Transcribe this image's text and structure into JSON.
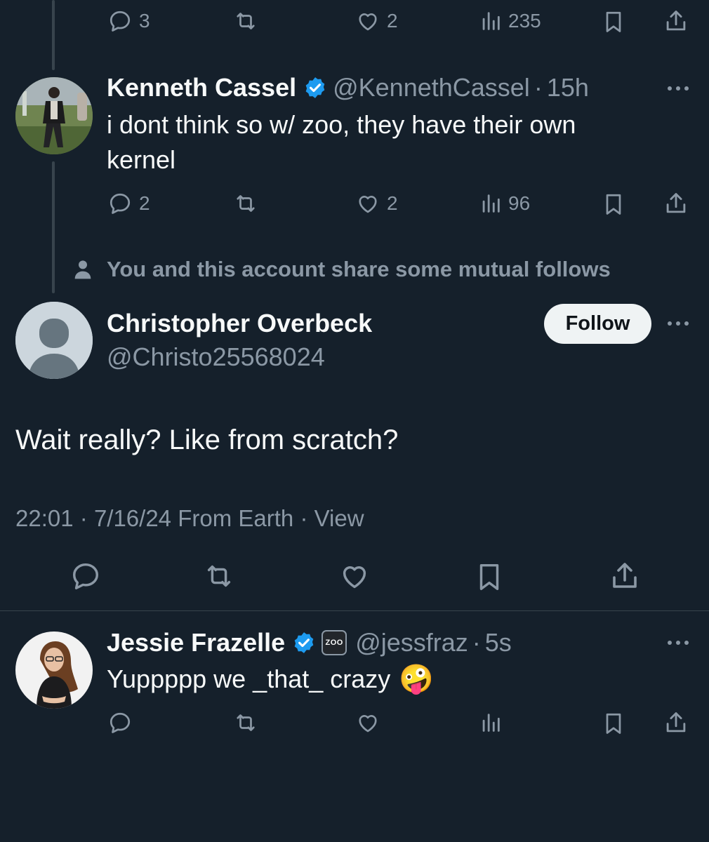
{
  "top_actions": {
    "replies": "3",
    "likes": "2",
    "views": "235"
  },
  "tweet1": {
    "name": "Kenneth Cassel",
    "handle": "@KennethCassel",
    "time": "15h",
    "text_line1": "i dont think so w/ zoo, they have their own",
    "text_line2": "kernel",
    "replies": "2",
    "likes": "2",
    "views": "96"
  },
  "mutual_follows": "You and this account share some mutual follows",
  "focus_tweet": {
    "name": "Christopher Overbeck",
    "handle": "@Christo25568024",
    "follow_label": "Follow",
    "text": "Wait really? Like from scratch?",
    "time": "22:01",
    "date": "7/16/24",
    "location": "From Earth",
    "view_label": "View"
  },
  "reply_tweet": {
    "name": "Jessie Frazelle",
    "affiliate_badge": "ZOO",
    "handle": "@jessfraz",
    "time": "5s",
    "text": "Yuppppp we _that_ crazy",
    "emoji": "🤪"
  },
  "colors": {
    "background": "#15202b",
    "primary_text": "#f7f9f9",
    "secondary_text": "#8b98a5",
    "verified_blue": "#1d9bf0",
    "divider": "#38444d"
  },
  "icons": [
    "reply-icon",
    "retweet-icon",
    "like-icon",
    "views-icon",
    "bookmark-icon",
    "share-icon",
    "more-icon",
    "verified-icon",
    "person-icon"
  ]
}
